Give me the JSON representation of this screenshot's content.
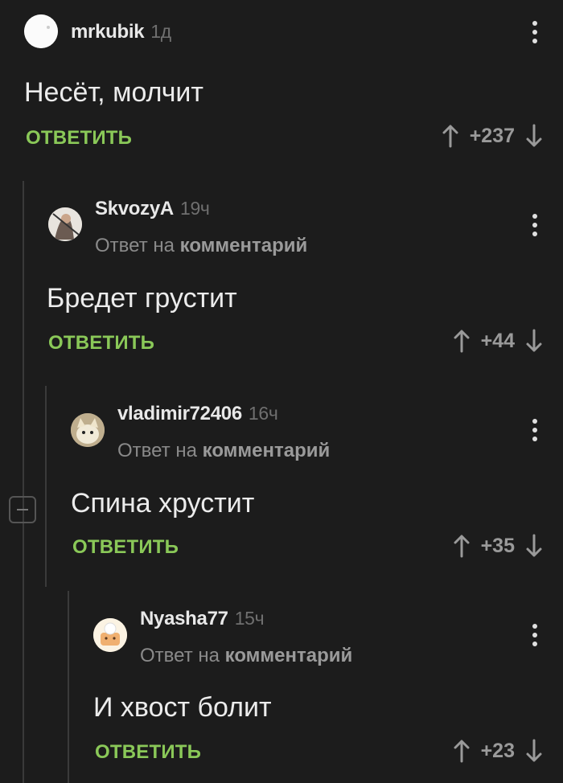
{
  "comments": [
    {
      "author": "mrkubik",
      "time": "1д",
      "reply_to": null,
      "text": "Несёт, молчит",
      "reply_label": "ОТВЕТИТЬ",
      "score": "+237",
      "avatar": "white-blob-avatar"
    },
    {
      "author": "SkvozyA",
      "time": "19ч",
      "reply_to_prefix": "Ответ на",
      "reply_to_link": "комментарий",
      "text": "Бредет грустит",
      "reply_label": "ОТВЕТИТЬ",
      "score": "+44",
      "avatar": "warrior-avatar"
    },
    {
      "author": "vladimir72406",
      "time": "16ч",
      "reply_to_prefix": "Ответ на",
      "reply_to_link": "комментарий",
      "text": "Спина хрустит",
      "reply_label": "ОТВЕТИТЬ",
      "score": "+35",
      "avatar": "cat-avatar"
    },
    {
      "author": "Nyasha77",
      "time": "15ч",
      "reply_to_prefix": "Ответ на",
      "reply_to_link": "комментарий",
      "text": "И хвост болит",
      "reply_label": "ОТВЕТИТЬ",
      "score": "+23",
      "avatar": "chef-avatar"
    }
  ],
  "colors": {
    "accent_green": "#8ac858",
    "background": "#1c1c1c"
  },
  "icons": {
    "menu": "more-vertical-icon",
    "up": "arrow-up-icon",
    "down": "arrow-down-icon",
    "collapse": "collapse-minus-icon"
  }
}
